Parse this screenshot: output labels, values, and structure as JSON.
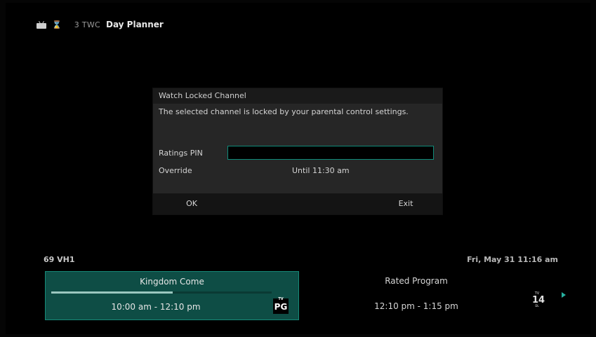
{
  "topbar": {
    "icons": [
      "tv-icon",
      "hourglass-icon"
    ],
    "channel": "3 TWC",
    "title": "Day Planner"
  },
  "dialog": {
    "header": "Watch Locked Channel",
    "message": "The selected channel is locked by your parental control settings.",
    "pin_label": "Ratings PIN",
    "pin_value": "",
    "override_label": "Override",
    "override_value": "Until 11:30 am",
    "ok_label": "OK",
    "exit_label": "Exit"
  },
  "info_bar": {
    "channel": "69 VH1",
    "datetime": "Fri, May 31 11:16 am"
  },
  "programs": {
    "current": {
      "name": "Kingdom Come",
      "time": "10:00 am - 12:10 pm",
      "rating_tv": "TV",
      "rating": "PG",
      "progress_fraction": 0.55
    },
    "next": {
      "name": "Rated Program",
      "time": "12:10 pm - 1:15 pm",
      "rating_tv": "TV",
      "rating": "14",
      "rating_sub": "DL"
    }
  },
  "colors": {
    "accent": "#168a79",
    "highlight_bg": "#0e4d45",
    "arrow": "#27b1a0"
  }
}
